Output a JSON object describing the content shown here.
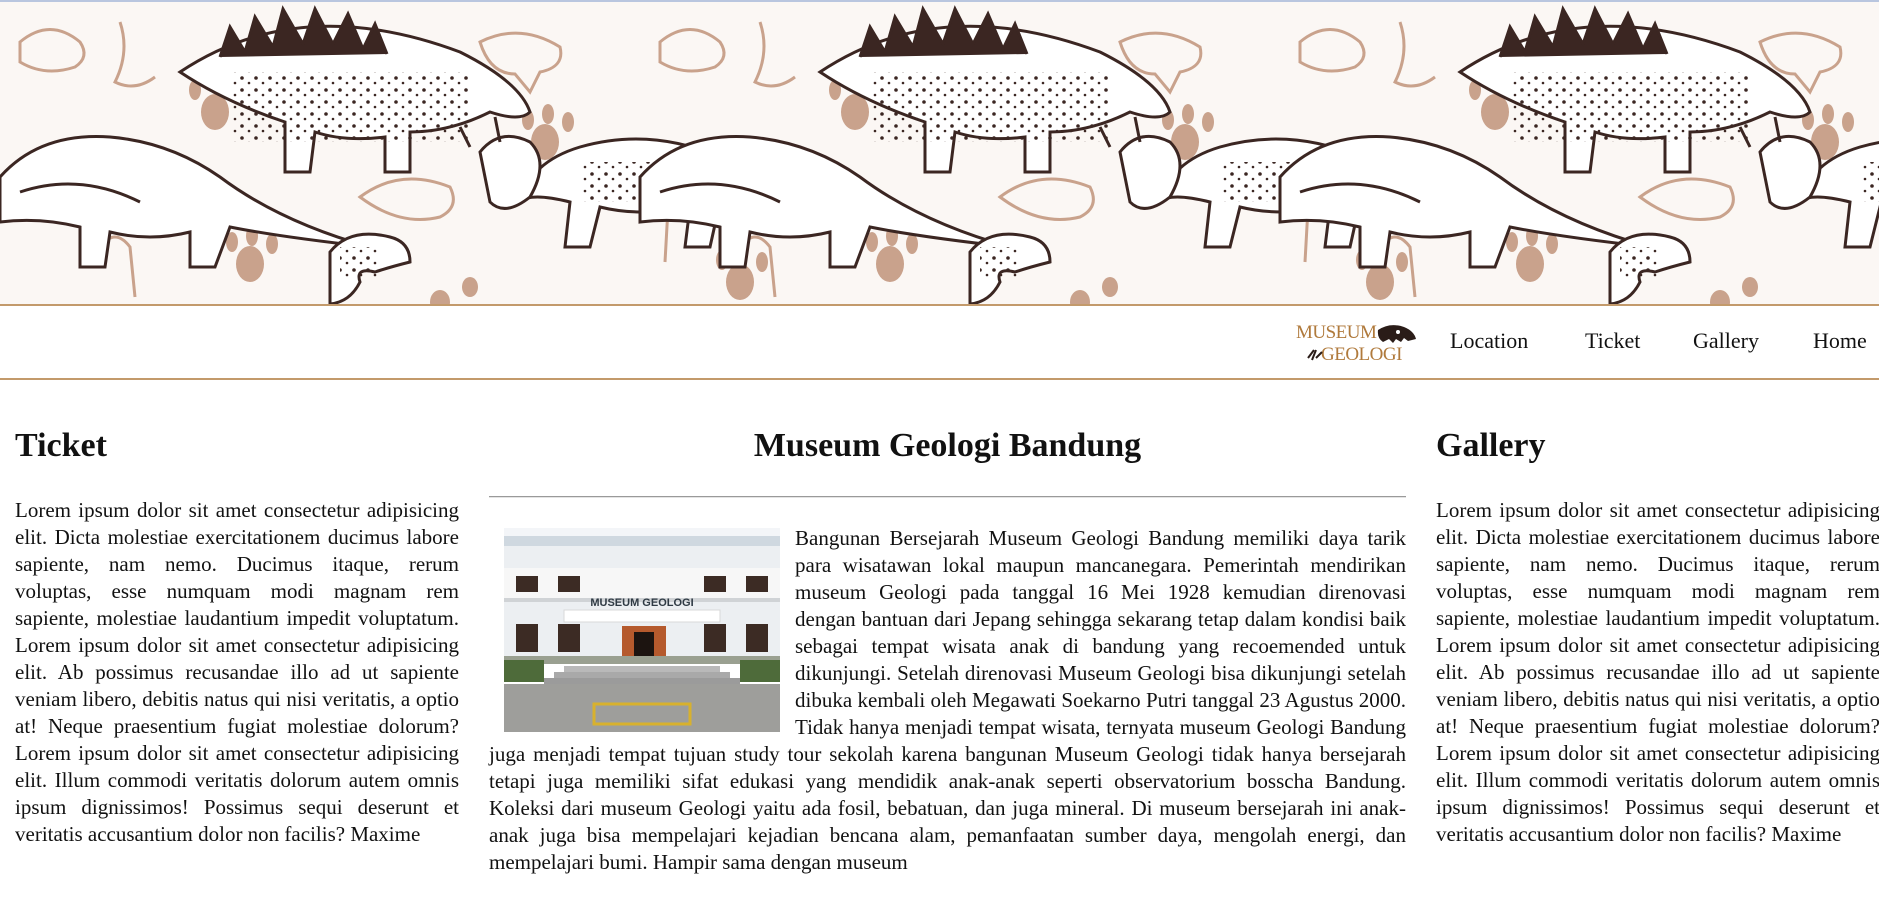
{
  "nav": {
    "logo_top": "MUSEUM",
    "logo_bottom": "GEOLOGI",
    "items": [
      {
        "label": "Location"
      },
      {
        "label": "Ticket"
      },
      {
        "label": "Gallery"
      },
      {
        "label": "Home"
      }
    ]
  },
  "ticket": {
    "title": "Ticket",
    "text": "Lorem ipsum dolor sit amet consectetur adipisicing elit. Dicta molestiae exercitationem ducimus labore sapiente, nam nemo. Ducimus itaque, rerum voluptas, esse numquam modi magnam rem sapiente, molestiae laudantium impedit voluptatum. Lorem ipsum dolor sit amet consectetur adipisicing elit. Ab possimus recusandae illo ad ut sapiente veniam libero, debitis natus qui nisi veritatis, a optio at! Neque praesentium fugiat molestiae dolorum? Lorem ipsum dolor sit amet consectetur adipisicing elit. Illum commodi veritatis dolorum autem omnis ipsum dignissimos! Possimus sequi deserunt et veritatis accusantium dolor non facilis? Maxime"
  },
  "main": {
    "title": "Museum Geologi Bandung",
    "photo_sign": "MUSEUM GEOLOGI",
    "text": "Bangunan Bersejarah Museum Geologi Bandung memiliki daya tarik para wisatawan lokal maupun mancanegara. Pemerintah mendirikan museum Geologi pada tanggal 16 Mei 1928 kemudian direnovasi dengan bantuan dari Jepang sehingga sekarang tetap dalam kondisi baik sebagai tempat wisata anak di bandung yang recoemended untuk dikunjungi. Setelah direnovasi Museum Geologi bisa dikunjungi setelah dibuka kembali oleh Megawati Soekarno Putri tanggal 23 Agustus 2000. Tidak hanya menjadi tempat wisata, ternyata museum Geologi Bandung juga menjadi tempat tujuan study tour sekolah karena bangunan Museum Geologi tidak hanya bersejarah tetapi juga memiliki sifat edukasi yang mendidik anak-anak seperti observatorium bosscha Bandung. Koleksi dari museum Geologi yaitu ada fosil, bebatuan, dan juga mineral. Di museum bersejarah ini anak-anak juga bisa mempelajari kejadian bencana alam, pemanfaatan sumber daya, mengolah energi, dan mempelajari bumi. Hampir sama dengan museum"
  },
  "gallery": {
    "title": "Gallery",
    "text": "Lorem ipsum dolor sit amet consectetur adipisicing elit. Dicta molestiae exercitationem ducimus labore sapiente, nam nemo. Ducimus itaque, rerum voluptas, esse numquam modi magnam rem sapiente, molestiae laudantium impedit voluptatum. Lorem ipsum dolor sit amet consectetur adipisicing elit. Ab possimus recusandae illo ad ut sapiente veniam libero, debitis natus qui nisi veritatis, a optio at! Neque praesentium fugiat molestiae dolorum? Lorem ipsum dolor sit amet consectetur adipisicing elit. Illum commodi veritatis dolorum autem omnis ipsum dignissimos! Possimus sequi deserunt et veritatis accusantium dolor non facilis? Maxime"
  },
  "colors": {
    "accent": "#c39a6b",
    "dino_ink": "#3b2622",
    "dino_tan": "#c9a28c"
  }
}
